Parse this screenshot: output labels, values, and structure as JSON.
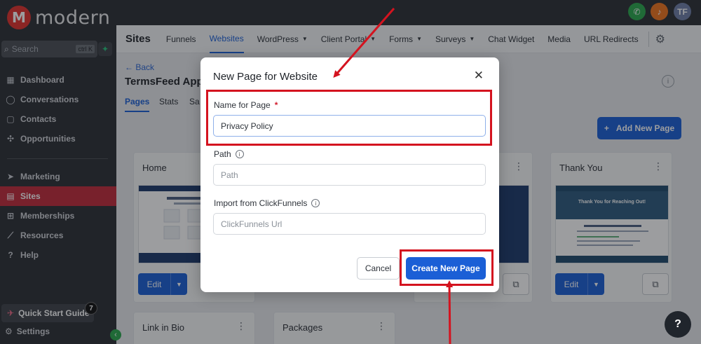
{
  "brand": {
    "name": "modern"
  },
  "sidebar": {
    "search_placeholder": "Search",
    "search_shortcut": "ctrl K",
    "items_top": [
      {
        "label": "Dashboard",
        "icon": "dashboard-icon"
      },
      {
        "label": "Conversations",
        "icon": "chat-icon"
      },
      {
        "label": "Contacts",
        "icon": "contacts-icon"
      },
      {
        "label": "Opportunities",
        "icon": "opportunities-icon"
      }
    ],
    "items_bottom": [
      {
        "label": "Marketing",
        "icon": "send-icon"
      },
      {
        "label": "Sites",
        "icon": "sites-icon",
        "active": true
      },
      {
        "label": "Memberships",
        "icon": "memberships-icon"
      },
      {
        "label": "Resources",
        "icon": "resources-icon"
      },
      {
        "label": "Help",
        "icon": "help-icon"
      }
    ],
    "quick_start": "Quick Start Guide",
    "quick_start_badge": "7",
    "settings": "Settings"
  },
  "topbar": {
    "avatar_initials": "TF",
    "colors": {
      "phone": "#2aa84d",
      "bell": "#f0741d",
      "avatar": "#6e7ea8"
    }
  },
  "subnav": {
    "title": "Sites",
    "tabs": [
      {
        "label": "Funnels"
      },
      {
        "label": "Websites",
        "active": true
      },
      {
        "label": "WordPress",
        "dropdown": true
      },
      {
        "label": "Client Portal",
        "dropdown": true
      },
      {
        "label": "Forms",
        "dropdown": true
      },
      {
        "label": "Surveys",
        "dropdown": true
      },
      {
        "label": "Chat Widget"
      },
      {
        "label": "Media"
      },
      {
        "label": "URL Redirects"
      }
    ]
  },
  "content": {
    "back": "← Back",
    "project_title": "TermsFeed App",
    "tabs": [
      "Pages",
      "Stats",
      "Sa"
    ],
    "add_page": "Add New Page",
    "cards": [
      {
        "title": "Home",
        "edit": "Edit"
      },
      {
        "title": "Thank You",
        "edit": "Edit",
        "thumb_heading": "Thank You for Reaching Out!"
      },
      {
        "title": "Link in Bio"
      },
      {
        "title": "Packages"
      }
    ]
  },
  "modal": {
    "title": "New Page for Website",
    "name_label": "Name for Page",
    "name_required": "*",
    "name_value": "Privacy Policy",
    "path_label": "Path",
    "path_placeholder": "Path",
    "import_label": "Import from ClickFunnels",
    "import_placeholder": "ClickFunnels Url",
    "cancel": "Cancel",
    "create": "Create New Page"
  },
  "colors": {
    "accent": "#1b5fd6",
    "sidebar": "#2c2f35",
    "active_nav": "#c22a3a",
    "highlight": "#d4131f"
  }
}
